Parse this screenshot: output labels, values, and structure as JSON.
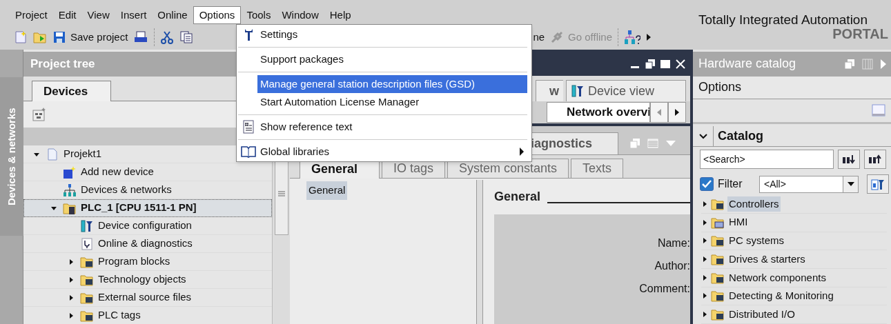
{
  "menu_bar": [
    {
      "label": "Project",
      "selected": false
    },
    {
      "label": "Edit",
      "selected": false
    },
    {
      "label": "View",
      "selected": false
    },
    {
      "label": "Insert",
      "selected": false
    },
    {
      "label": "Online",
      "selected": false
    },
    {
      "label": "Options",
      "selected": true
    },
    {
      "label": "Tools",
      "selected": false
    },
    {
      "label": "Window",
      "selected": false
    },
    {
      "label": "Help",
      "selected": false
    }
  ],
  "toolbar": [
    {
      "kind": "new"
    },
    {
      "kind": "open"
    },
    {
      "kind": "save",
      "label": "Save project"
    },
    {
      "kind": "print"
    },
    {
      "kind": "sep"
    },
    {
      "kind": "cut"
    },
    {
      "kind": "copy"
    },
    {
      "kind": "text",
      "label": "ne"
    },
    {
      "kind": "offline",
      "label": "Go offline",
      "disabled": true
    },
    {
      "kind": "sep"
    },
    {
      "kind": "help"
    },
    {
      "kind": "more"
    }
  ],
  "brand": {
    "title": "Totally Integrated Automation",
    "subtitle": "PORTAL"
  },
  "options_menu": [
    {
      "kind": "settings",
      "label": "Settings",
      "selected": false
    },
    {
      "kind": "separator"
    },
    {
      "kind": "plain",
      "label": "Support packages",
      "selected": false
    },
    {
      "kind": "separator"
    },
    {
      "kind": "plain",
      "label": "Manage general station description files (GSD)",
      "selected": true
    },
    {
      "kind": "plain",
      "label": "Start Automation License Manager",
      "selected": false
    },
    {
      "kind": "separator"
    },
    {
      "kind": "reference",
      "label": "Show reference text",
      "selected": false
    },
    {
      "kind": "separator"
    },
    {
      "kind": "library",
      "label": "Global libraries",
      "selected": false,
      "submenu": true
    }
  ],
  "side_tab": "Devices & networks",
  "project_tree": {
    "title": "Project tree",
    "tabs": [
      {
        "label": "Devices",
        "selected": true
      }
    ],
    "items": [
      {
        "label": "Projekt1",
        "kind": "project",
        "expanded": true,
        "selected": false,
        "children": [
          {
            "label": "Add new device",
            "kind": "add",
            "selected": false
          },
          {
            "label": "Devices & networks",
            "kind": "network",
            "selected": false
          },
          {
            "label": "PLC_1 [CPU 1511-1 PN]",
            "kind": "plc",
            "expanded": true,
            "selected": true,
            "children": [
              {
                "label": "Device configuration",
                "kind": "config",
                "selected": false
              },
              {
                "label": "Online & diagnostics",
                "kind": "diagnostics",
                "selected": false
              },
              {
                "label": "Program blocks",
                "kind": "folder",
                "expanded": false,
                "selected": false
              },
              {
                "label": "Technology objects",
                "kind": "folder",
                "expanded": false,
                "selected": false
              },
              {
                "label": "External source files",
                "kind": "folder",
                "expanded": false,
                "selected": false
              },
              {
                "label": "PLC tags",
                "kind": "folder",
                "expanded": false,
                "selected": false
              }
            ]
          }
        ]
      }
    ]
  },
  "editor": {
    "view_tabs": [
      {
        "label": "w",
        "selected": false
      },
      {
        "label": "Device view",
        "selected": false
      }
    ],
    "sub_tab": "Network overvi",
    "inspector_tab": "iagnostics",
    "tabs": [
      {
        "label": "General",
        "selected": true
      },
      {
        "label": "IO tags",
        "selected": false
      },
      {
        "label": "System constants",
        "selected": false
      },
      {
        "label": "Texts",
        "selected": false
      }
    ],
    "nav": [
      {
        "label": "General",
        "selected": true
      }
    ],
    "section": "General",
    "fields": [
      "Name:",
      "Author:",
      "Comment:"
    ]
  },
  "catalog": {
    "title": "Hardware catalog",
    "options_label": "Options",
    "section": "Catalog",
    "expanded": true,
    "search": {
      "placeholder": "<Search>"
    },
    "filter": {
      "label": "Filter",
      "checked": true,
      "value": "<All>"
    },
    "items": [
      {
        "label": "Controllers",
        "kind": "folder",
        "selected": true
      },
      {
        "label": "HMI",
        "kind": "hmi",
        "selected": false
      },
      {
        "label": "PC systems",
        "kind": "folder",
        "selected": false
      },
      {
        "label": "Drives & starters",
        "kind": "folder",
        "selected": false
      },
      {
        "label": "Network components",
        "kind": "folder",
        "selected": false
      },
      {
        "label": "Detecting & Monitoring",
        "kind": "folder",
        "selected": false
      },
      {
        "label": "Distributed I/O",
        "kind": "folder",
        "selected": false
      }
    ]
  }
}
